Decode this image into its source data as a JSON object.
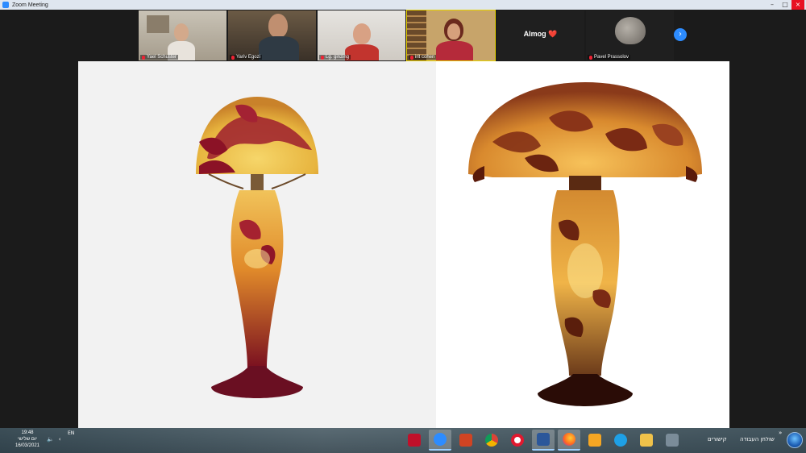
{
  "window": {
    "title": "Zoom Meeting"
  },
  "participants": [
    {
      "name": "Yael Schuster",
      "muted": true
    },
    {
      "name": "Yariv Egozi",
      "muted": true
    },
    {
      "name": "Lg. ginzing",
      "muted": true
    },
    {
      "name": "irit cohen",
      "muted": true,
      "active": true
    },
    {
      "name": "Almog ❤️",
      "muted": false,
      "video": false
    },
    {
      "name": "Pavel Prassolov",
      "muted": true
    }
  ],
  "taskbar": {
    "time": "19:48",
    "day": "יום שלישי",
    "date": "16/03/2021",
    "lang": "EN",
    "links_label": "קישורים",
    "desktop_label": "שולחן העבודה",
    "apps": [
      {
        "icon": "mcafee-icon",
        "color": "#c0102a"
      },
      {
        "icon": "zoom-icon",
        "color": "#2d8cff",
        "active": true
      },
      {
        "icon": "powerpoint-icon",
        "color": "#d04423"
      },
      {
        "icon": "chrome-icon",
        "color": "#f2c12e"
      },
      {
        "icon": "opera-icon",
        "color": "#e0192f"
      },
      {
        "icon": "word-icon",
        "color": "#2b579a",
        "active": true
      },
      {
        "icon": "firefox-icon",
        "color": "#ff6a20",
        "active": true
      },
      {
        "icon": "media-player-icon",
        "color": "#f5a623"
      },
      {
        "icon": "internet-explorer-icon",
        "color": "#1ea0e6"
      },
      {
        "icon": "file-explorer-icon",
        "color": "#f0c24a"
      },
      {
        "icon": "calculator-icon",
        "color": "#7b8c99"
      }
    ]
  },
  "colors": {
    "zoom_blue": "#2d8cff",
    "active_speaker": "#e6d200"
  }
}
